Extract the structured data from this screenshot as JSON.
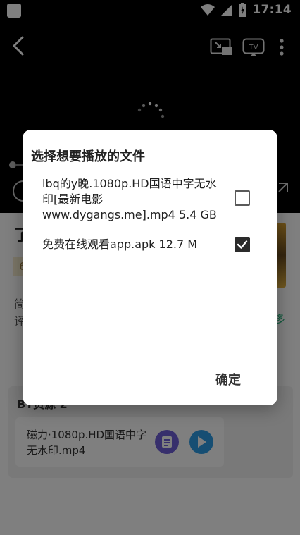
{
  "status_bar": {
    "time": "17:14"
  },
  "icons": {
    "back": "back-arrow-icon",
    "pip": "picture-in-picture-icon",
    "tv": "tv-cast-icon",
    "more": "more-vertical-icon",
    "spinner": "loading-spinner-icon",
    "expand": "fullscreen-icon"
  },
  "tv_label": "TV",
  "detail": {
    "title": "了",
    "score": "6",
    "desc_line1": "简",
    "desc_line2": "译",
    "more": "多"
  },
  "section": {
    "title": "BT资源 2",
    "file_card": {
      "name": "磁力·1080p.HD国语中字无水印.mp4"
    }
  },
  "dialog": {
    "title": "选择想要播放的文件",
    "files": [
      {
        "label": "lbq的y晚.1080p.HD国语中字无水印[最新电影www.dygangs.me].mp4 5.4 GB",
        "checked": false
      },
      {
        "label": "免费在线观看app.apk 12.7 M",
        "checked": true
      }
    ],
    "confirm_label": "确定"
  },
  "colors": {
    "accent_green": "#23b37a",
    "doc_purple": "#6e5fd9",
    "play_blue": "#2c9ce6"
  }
}
